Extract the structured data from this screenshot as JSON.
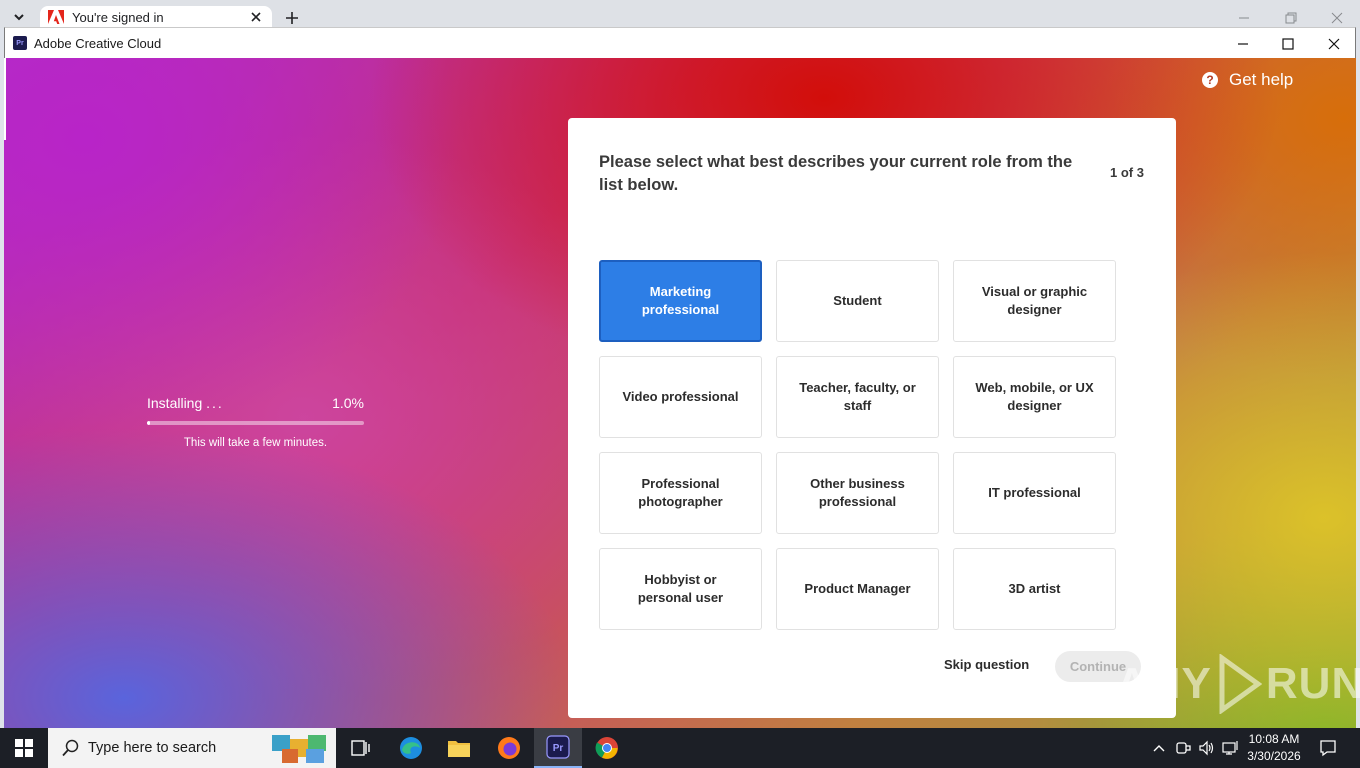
{
  "browser": {
    "tab_title": "You're signed in"
  },
  "window": {
    "title": "Adobe Creative Cloud",
    "app_icon_text": "Pr"
  },
  "help": {
    "label": "Get help"
  },
  "install": {
    "status": "Installing",
    "dots": "...",
    "percent_text": "1.0%",
    "progress_fraction": 0.01,
    "note": "This will take a few minutes."
  },
  "dialog": {
    "question": "Please select what best describes your current role from the list below.",
    "step": "1 of 3",
    "options": [
      {
        "label": "Marketing professional",
        "selected": true
      },
      {
        "label": "Student",
        "selected": false
      },
      {
        "label": "Visual or graphic designer",
        "selected": false
      },
      {
        "label": "Video professional",
        "selected": false
      },
      {
        "label": "Teacher, faculty, or staff",
        "selected": false
      },
      {
        "label": "Web, mobile, or UX designer",
        "selected": false
      },
      {
        "label": "Professional photographer",
        "selected": false
      },
      {
        "label": "Other business professional",
        "selected": false
      },
      {
        "label": "IT professional",
        "selected": false
      },
      {
        "label": "Hobbyist or personal user",
        "selected": false
      },
      {
        "label": "Product Manager",
        "selected": false
      },
      {
        "label": "3D artist",
        "selected": false
      }
    ],
    "skip_label": "Skip question",
    "continue_label": "Continue"
  },
  "watermark": {
    "left": "ANY",
    "right": "RUN"
  },
  "taskbar": {
    "search_placeholder": "Type here to search",
    "time": "10:08 AM",
    "date": "3/30/2026"
  },
  "colors": {
    "selected_option": "#2d7ee6",
    "continue_disabled_bg": "#ececec"
  }
}
